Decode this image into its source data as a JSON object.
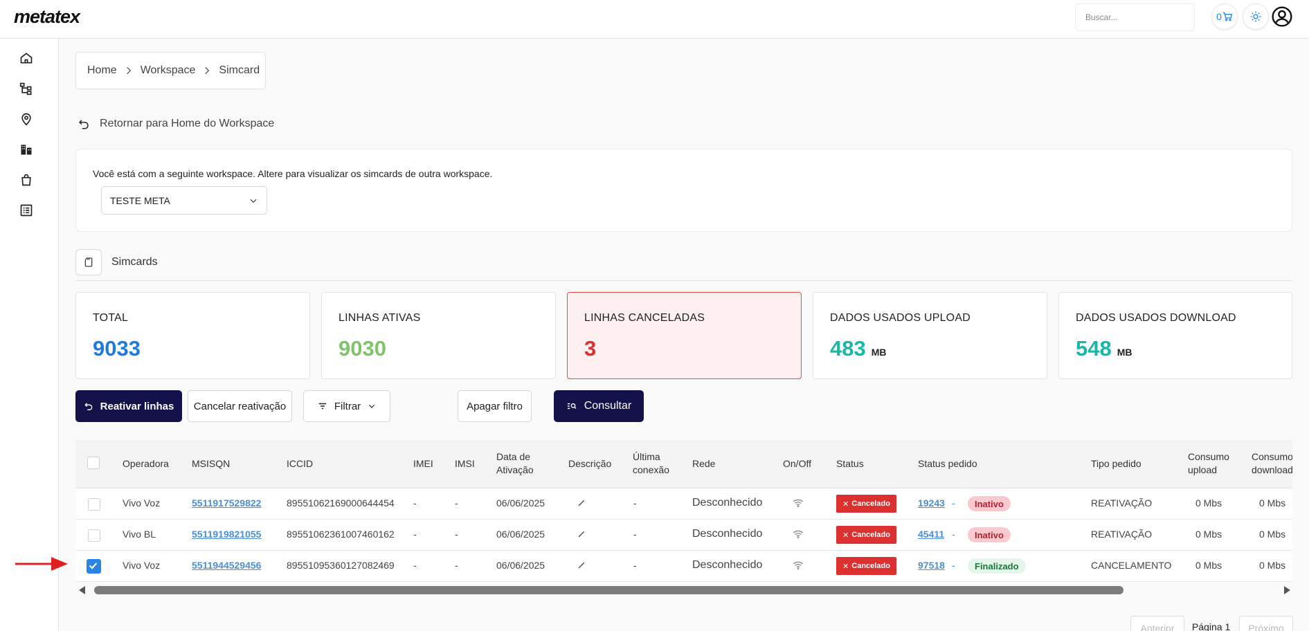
{
  "app": {
    "logo": "metatex"
  },
  "topbar": {
    "search_placeholder": "Buscar...",
    "cart_count": "0"
  },
  "breadcrumb": [
    "Home",
    "Workspace",
    "Simcard"
  ],
  "back_link": "Retornar para Home do Workspace",
  "workspace": {
    "info": "Você está com a seguinte workspace. Altere para visualizar os simcards de outra workspace.",
    "selected": "TESTE META"
  },
  "section_title": "Simcards",
  "stats": [
    {
      "label": "TOTAL",
      "value": "9033",
      "unit": "",
      "color": "#1e7be0"
    },
    {
      "label": "LINHAS ATIVAS",
      "value": "9030",
      "unit": "",
      "color": "#7fc46a"
    },
    {
      "label": "LINHAS CANCELADAS",
      "value": "3",
      "unit": "",
      "color": "#d93030"
    },
    {
      "label": "DADOS USADOS UPLOAD",
      "value": "483",
      "unit": "MB",
      "color": "#18b8a8"
    },
    {
      "label": "DADOS USADOS DOWNLOAD",
      "value": "548",
      "unit": "MB",
      "color": "#18b8a8"
    }
  ],
  "actions": {
    "reactivate": "Reativar linhas",
    "cancel_reactivation": "Cancelar reativação",
    "filter": "Filtrar",
    "clear_filter": "Apagar filtro",
    "query": "Consultar"
  },
  "table": {
    "headers": {
      "operadora": "Operadora",
      "msisdn": "MSISQN",
      "iccid": "ICCID",
      "imei": "IMEI",
      "imsi": "IMSI",
      "data_ativacao_1": "Data de",
      "data_ativacao_2": "Ativação",
      "descricao": "Descrição",
      "ultima_1": "Última",
      "ultima_2": "conexão",
      "rede": "Rede",
      "onoff": "On/Off",
      "status": "Status",
      "status_pedido": "Status pedido",
      "tipo_pedido": "Tipo pedido",
      "consumo_up_1": "Consumo",
      "consumo_up_2": "upload",
      "consumo_down_1": "Consumo",
      "consumo_down_2": "download"
    },
    "rows": [
      {
        "operadora": "Vivo Voz",
        "msisdn": "5511917529822",
        "iccid": "89551062169000644454",
        "imei": "-",
        "imsi": "-",
        "data": "06/06/2025",
        "ultima": "-",
        "rede": "Desconhecido",
        "status": "Cancelado",
        "pedido": "19243",
        "sep": "-",
        "pedido_status": "Inativo",
        "tipo": "REATIVAÇÃO",
        "up": "0 Mbs",
        "down": "0 Mbs",
        "checked": false
      },
      {
        "operadora": "Vivo BL",
        "msisdn": "5511919821055",
        "iccid": "89551062361007460162",
        "imei": "-",
        "imsi": "-",
        "data": "06/06/2025",
        "ultima": "-",
        "rede": "Desconhecido",
        "status": "Cancelado",
        "pedido": "45411",
        "sep": "-",
        "pedido_status": "Inativo",
        "tipo": "REATIVAÇÃO",
        "up": "0 Mbs",
        "down": "0 Mbs",
        "checked": false
      },
      {
        "operadora": "Vivo Voz",
        "msisdn": "5511944529456",
        "iccid": "89551095360127082469",
        "imei": "-",
        "imsi": "-",
        "data": "06/06/2025",
        "ultima": "-",
        "rede": "Desconhecido",
        "status": "Cancelado",
        "pedido": "97518",
        "sep": "-",
        "pedido_status": "Finalizado",
        "tipo": "CANCELAMENTO",
        "up": "0 Mbs",
        "down": "0 Mbs",
        "checked": true
      }
    ]
  },
  "pagination": {
    "prev": "Anterior",
    "page": "Página 1",
    "next": "Próximo"
  }
}
